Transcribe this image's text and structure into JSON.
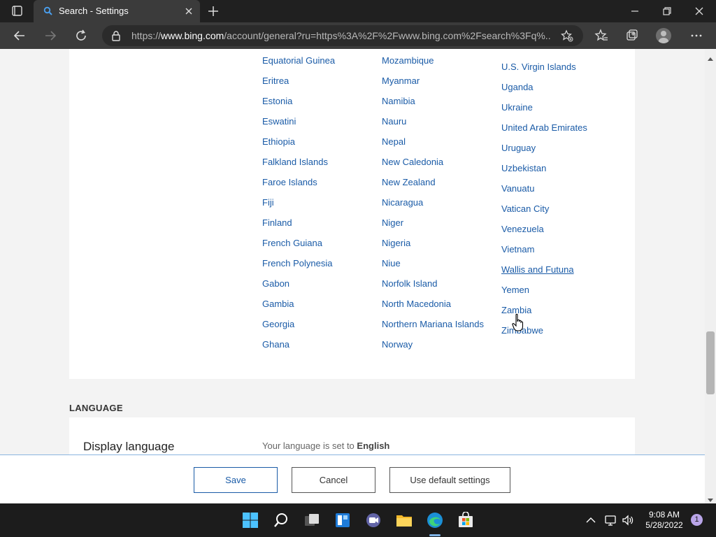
{
  "browser": {
    "tab_title": "Search - Settings",
    "url_prefix": "https://",
    "url_domain": "www.bing.com",
    "url_rest": "/account/general?ru=https%3A%2F%2Fwww.bing.com%2Fsearch%3Fq%..."
  },
  "countries": {
    "col1": [
      "Equatorial Guinea",
      "Eritrea",
      "Estonia",
      "Eswatini",
      "Ethiopia",
      "Falkland Islands",
      "Faroe Islands",
      "Fiji",
      "Finland",
      "French Guiana",
      "French Polynesia",
      "Gabon",
      "Gambia",
      "Georgia",
      "Ghana"
    ],
    "col2": [
      "Mozambique",
      "Myanmar",
      "Namibia",
      "Nauru",
      "Nepal",
      "New Caledonia",
      "New Zealand",
      "Nicaragua",
      "Niger",
      "Nigeria",
      "Niue",
      "Norfolk Island",
      "North Macedonia",
      "Northern Mariana Islands",
      "Norway"
    ],
    "col3": [
      "U.S. Virgin Islands",
      "Uganda",
      "Ukraine",
      "United Arab Emirates",
      "Uruguay",
      "Uzbekistan",
      "Vanuatu",
      "Vatican City",
      "Venezuela",
      "Vietnam",
      "Wallis and Futuna",
      "Yemen",
      "Zambia",
      "Zimbabwe"
    ],
    "hovered": "Wallis and Futuna"
  },
  "language": {
    "section_heading": "LANGUAGE",
    "title": "Display language",
    "status_prefix": "Your language is set to",
    "status_value": "English"
  },
  "actions": {
    "save": "Save",
    "cancel": "Cancel",
    "defaults": "Use default settings"
  },
  "taskbar": {
    "time": "9:08 AM",
    "date": "5/28/2022",
    "notifications": "1"
  },
  "colors": {
    "link": "#1a5ba7",
    "accent": "#7fb2e5"
  }
}
